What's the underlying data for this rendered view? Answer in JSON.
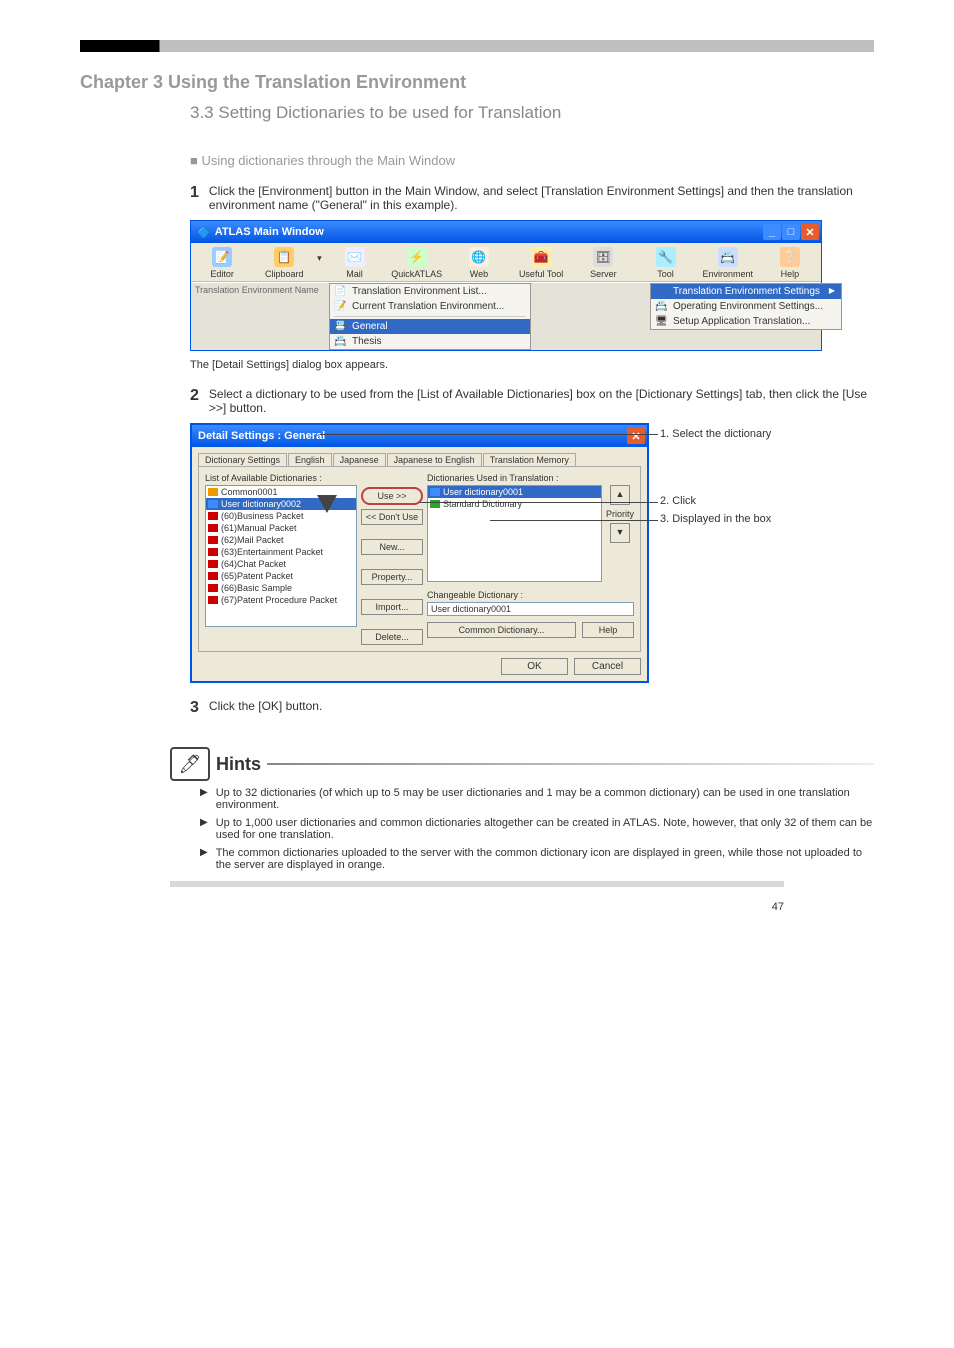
{
  "page": {
    "number": "47",
    "chapter_head": "Chapter 3   Using the Translation Environment",
    "section_title": "3.3 Setting Dictionaries to be used for Translation",
    "sub1": "■ Using dictionaries through the Main Window",
    "step1_num": "1",
    "step1": "Click the [Environment] button in the Main Window, and select [Translation Environment Settings] and then the translation environment name (\"General\" in this example).",
    "step_result": "The [Detail Settings] dialog box appears.",
    "step2_num": "2",
    "step2": "Select a dictionary to be used from the [List of Available Dictionaries] box on the [Dictionary Settings] tab, then click the [Use >>] button.",
    "step3_num": "3",
    "step3": "Click the [OK] button."
  },
  "atlas": {
    "title": "ATLAS Main Window",
    "tools": [
      "Editor",
      "Clipboard",
      "Mail",
      "QuickATLAS",
      "Web",
      "Useful Tool",
      "Server",
      "Tool",
      "Environment",
      "Help"
    ],
    "status_left": "Translation Environment Name",
    "menu1": [
      {
        "icon": "📄",
        "label": "Translation Environment List..."
      },
      {
        "icon": "📝",
        "label": "Current Translation Environment..."
      }
    ],
    "menu1b": [
      {
        "icon": "📇",
        "label": "General",
        "sel": true
      },
      {
        "icon": "📇",
        "label": "Thesis"
      }
    ],
    "menu2": [
      {
        "label": "Translation Environment Settings",
        "hover": true,
        "arrow": true
      },
      {
        "icon": "📇",
        "label": "Operating Environment Settings..."
      },
      {
        "icon": "🖥",
        "label": "Setup Application Translation..."
      }
    ]
  },
  "dialog": {
    "title": "Detail Settings : General",
    "tabs": [
      "Dictionary Settings",
      "English",
      "Japanese",
      "Japanese to English",
      "Translation Memory"
    ],
    "left_label": "List of Available Dictionaries :",
    "right_label": "Dictionaries Used in Translation :",
    "available": [
      {
        "label": "Common0001",
        "icon": "orange"
      },
      {
        "label": "User dictionary0002",
        "sel": true,
        "icon": "blue"
      },
      {
        "label": "(60)Business Packet"
      },
      {
        "label": "(61)Manual Packet"
      },
      {
        "label": "(62)Mail Packet"
      },
      {
        "label": "(63)Entertainment Packet"
      },
      {
        "label": "(64)Chat Packet"
      },
      {
        "label": "(65)Patent Packet"
      },
      {
        "label": "(66)Basic Sample"
      },
      {
        "label": "(67)Patent Procedure Packet"
      }
    ],
    "buttons_mid": {
      "use": "Use  >>",
      "dont": "<<  Don't Use",
      "new": "New...",
      "prop": "Property...",
      "import": "Import...",
      "delete": "Delete..."
    },
    "used": [
      {
        "label": "User dictionary0001",
        "sel": true
      },
      {
        "label": "Standard Dictionary"
      }
    ],
    "priority_label": "Priority",
    "changeable_label": "Changeable Dictionary :",
    "changeable_val": "User dictionary0001",
    "common_btn": "Common Dictionary...",
    "help_btn": "Help",
    "ok": "OK",
    "cancel": "Cancel",
    "annot1": "1. Select the dictionary",
    "annot2": "2. Click",
    "annot3": "3. Displayed in the box"
  },
  "hints": {
    "title": "Hints",
    "items": [
      "Up to 32 dictionaries (of which up to 5 may be user dictionaries and 1 may be a common dictionary) can be used in one translation environment.",
      "Up to 1,000 user dictionaries and common dictionaries altogether can be created in ATLAS. Note, however, that only 32 of them can be used for one translation.",
      "The common dictionaries uploaded to the server with the common dictionary icon are displayed in green, while those not uploaded to the server are displayed in orange."
    ]
  }
}
